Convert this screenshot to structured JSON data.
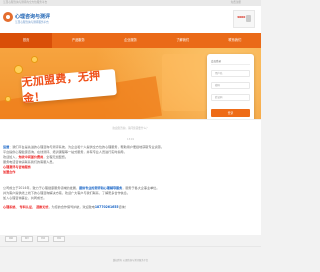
{
  "topbar": {
    "hint": "江西心理咨询与测评的全方位服务平台",
    "action": "免费注册"
  },
  "header": {
    "brand": "心理咨询与测评",
    "subtitle": "江西心理咨询与测评服务平台",
    "phone_label": "4000"
  },
  "nav": {
    "items": [
      "首页",
      "产品服务",
      "企业服务",
      "了解我们",
      "联系我们"
    ]
  },
  "hero": {
    "promo": "无加盟费，无押金！",
    "login": {
      "tab": "会员登录",
      "username_placeholder": "用户名",
      "password_placeholder": "密码",
      "code_placeholder": "验证码",
      "button": "登录"
    }
  },
  "dialog": {
    "title": "欢迎您咨询，请问您需要什么？",
    "time": "13:19",
    "lines": [
      {
        "text": "运营",
        "rest": "：我们平台是先进的心理咨询与测评系统，为企业和个人提供全方位的心理服务，帮助用户便捷地获取专业资源。"
      },
      {
        "text": "",
        "rest": "平台提供心理健康咨询、在线测评、培训课程等一站式服务，并有专业人员进行实时指导。"
      },
      {
        "text": "",
        "rest": "欢迎加入，",
        "red": "免收中间差价费用",
        "tail": "，全程无加盟费。"
      },
      {
        "text": "",
        "rest": "服务电话咨询请联系我们的客服人员。"
      },
      {
        "text": "",
        "red": "心理测评与咨询服务",
        "rest": ""
      },
      {
        "text": "",
        "red": "加盟合作",
        "rest": ""
      },
      {
        "text": "",
        "rest": ""
      },
      {
        "text": "",
        "rest": "公司成立于2014年，致力于心理健康服务领域的发展，",
        "blue": "提供专业的测评和心理辅导服务",
        "tail": "，服务于各大企事业单位。"
      },
      {
        "text": "",
        "rest": "并为客户提供线上线下的心理咨询解决方案，欢迎广大客户与我们联系，了解更多合作信息。"
      },
      {
        "text": "",
        "rest": "加入心理咨询事业，共同成长。"
      },
      {
        "text": "",
        "red": "心理系统、 专科认证、 退款无忧",
        "rest": "，为您的合作保驾护航，欢迎致电",
        "blue": "18770261655",
        "tail": "咨询！"
      }
    ]
  },
  "mini_buttons": [
    "回复",
    "留言",
    "转接",
    "结束"
  ],
  "footer": {
    "text": "版权所有 心理咨询与测评服务平台"
  }
}
